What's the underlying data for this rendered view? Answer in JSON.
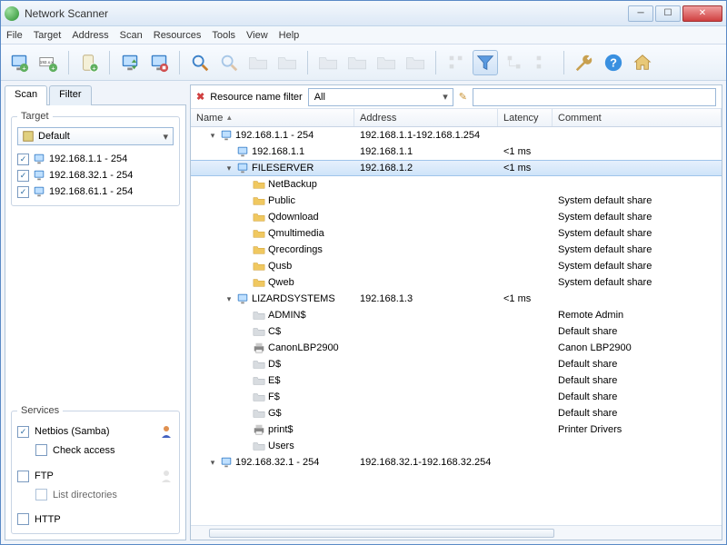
{
  "app": {
    "title": "Network Scanner"
  },
  "menus": [
    "File",
    "Target",
    "Address",
    "Scan",
    "Resources",
    "Tools",
    "View",
    "Help"
  ],
  "tabs": {
    "scan": "Scan",
    "filter": "Filter"
  },
  "target_panel": {
    "legend": "Target",
    "combo": "Default",
    "items": [
      "192.168.1.1 - 254",
      "192.168.32.1 - 254",
      "192.168.61.1 - 254"
    ]
  },
  "services_panel": {
    "legend": "Services",
    "netbios": "Netbios (Samba)",
    "check_access": "Check access",
    "ftp": "FTP",
    "list_dirs": "List directories",
    "http": "HTTP"
  },
  "filter": {
    "label": "Resource name filter",
    "combo": "All",
    "value": ""
  },
  "columns": {
    "name": "Name",
    "address": "Address",
    "latency": "Latency",
    "comment": "Comment"
  },
  "tree": [
    {
      "d": 0,
      "exp": "▾",
      "icon": "monitor",
      "name": "192.168.1.1 - 254",
      "addr": "192.168.1.1-192.168.1.254",
      "lat": "",
      "com": ""
    },
    {
      "d": 1,
      "exp": "",
      "icon": "monitor",
      "name": "192.168.1.1",
      "addr": "192.168.1.1",
      "lat": "<1 ms",
      "com": ""
    },
    {
      "d": 1,
      "exp": "▾",
      "icon": "monitor",
      "name": "FILESERVER",
      "addr": "192.168.1.2",
      "lat": "<1 ms",
      "com": "",
      "sel": true
    },
    {
      "d": 2,
      "exp": "",
      "icon": "folder",
      "name": "NetBackup",
      "addr": "",
      "lat": "",
      "com": ""
    },
    {
      "d": 2,
      "exp": "",
      "icon": "folder",
      "name": "Public",
      "addr": "",
      "lat": "",
      "com": "System default share"
    },
    {
      "d": 2,
      "exp": "",
      "icon": "folder",
      "name": "Qdownload",
      "addr": "",
      "lat": "",
      "com": "System default share"
    },
    {
      "d": 2,
      "exp": "",
      "icon": "folder",
      "name": "Qmultimedia",
      "addr": "",
      "lat": "",
      "com": "System default share"
    },
    {
      "d": 2,
      "exp": "",
      "icon": "folder",
      "name": "Qrecordings",
      "addr": "",
      "lat": "",
      "com": "System default share"
    },
    {
      "d": 2,
      "exp": "",
      "icon": "folder",
      "name": "Qusb",
      "addr": "",
      "lat": "",
      "com": "System default share"
    },
    {
      "d": 2,
      "exp": "",
      "icon": "folder",
      "name": "Qweb",
      "addr": "",
      "lat": "",
      "com": "System default share"
    },
    {
      "d": 1,
      "exp": "▾",
      "icon": "monitor",
      "name": "LIZARDSYSTEMS",
      "addr": "192.168.1.3",
      "lat": "<1 ms",
      "com": ""
    },
    {
      "d": 2,
      "exp": "",
      "icon": "folder-grey",
      "name": "ADMIN$",
      "addr": "",
      "lat": "",
      "com": "Remote Admin"
    },
    {
      "d": 2,
      "exp": "",
      "icon": "folder-grey",
      "name": "C$",
      "addr": "",
      "lat": "",
      "com": "Default share"
    },
    {
      "d": 2,
      "exp": "",
      "icon": "printer",
      "name": "CanonLBP2900",
      "addr": "",
      "lat": "",
      "com": "Canon LBP2900"
    },
    {
      "d": 2,
      "exp": "",
      "icon": "folder-grey",
      "name": "D$",
      "addr": "",
      "lat": "",
      "com": "Default share"
    },
    {
      "d": 2,
      "exp": "",
      "icon": "folder-grey",
      "name": "E$",
      "addr": "",
      "lat": "",
      "com": "Default share"
    },
    {
      "d": 2,
      "exp": "",
      "icon": "folder-grey",
      "name": "F$",
      "addr": "",
      "lat": "",
      "com": "Default share"
    },
    {
      "d": 2,
      "exp": "",
      "icon": "folder-grey",
      "name": "G$",
      "addr": "",
      "lat": "",
      "com": "Default share"
    },
    {
      "d": 2,
      "exp": "",
      "icon": "printer",
      "name": "print$",
      "addr": "",
      "lat": "",
      "com": "Printer Drivers"
    },
    {
      "d": 2,
      "exp": "",
      "icon": "folder-grey",
      "name": "Users",
      "addr": "",
      "lat": "",
      "com": ""
    },
    {
      "d": 0,
      "exp": "▾",
      "icon": "monitor",
      "name": "192.168.32.1 - 254",
      "addr": "192.168.32.1-192.168.32.254",
      "lat": "",
      "com": ""
    }
  ]
}
